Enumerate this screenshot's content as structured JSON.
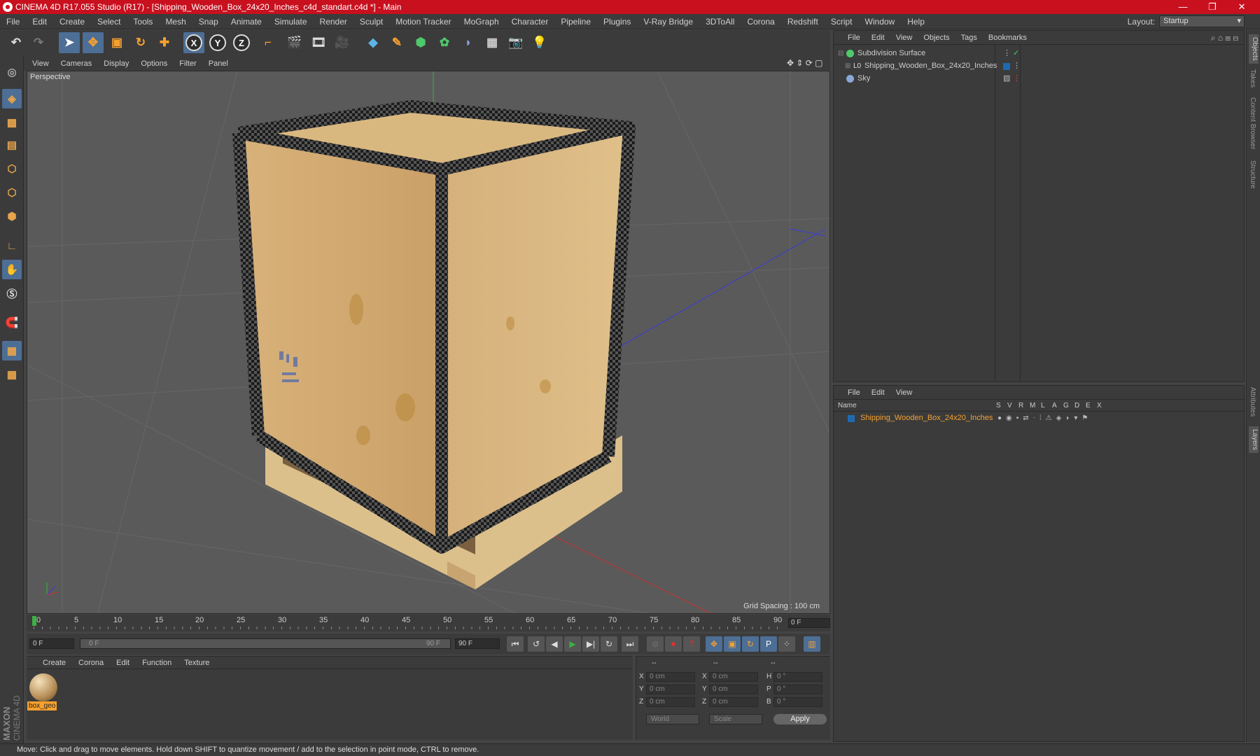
{
  "window": {
    "title": "CINEMA 4D R17.055 Studio (R17) - [Shipping_Wooden_Box_24x20_Inches_c4d_standart.c4d *] - Main",
    "minimize": "—",
    "maximize": "❐",
    "close": "✕"
  },
  "menu": [
    "File",
    "Edit",
    "Create",
    "Select",
    "Tools",
    "Mesh",
    "Snap",
    "Animate",
    "Simulate",
    "Render",
    "Sculpt",
    "Motion Tracker",
    "MoGraph",
    "Character",
    "Pipeline",
    "Plugins",
    "V-Ray Bridge",
    "3DToAll",
    "Corona",
    "Redshift",
    "Script",
    "Window",
    "Help"
  ],
  "layout": {
    "label": "Layout:",
    "value": "Startup"
  },
  "viewport": {
    "menu": [
      "View",
      "Cameras",
      "Display",
      "Options",
      "Filter",
      "Panel"
    ],
    "camera": "Perspective",
    "grid_spacing": "Grid Spacing : 100 cm"
  },
  "timeline": {
    "ticks": [
      "0",
      "5",
      "10",
      "15",
      "20",
      "25",
      "30",
      "35",
      "40",
      "45",
      "50",
      "55",
      "60",
      "65",
      "70",
      "75",
      "80",
      "85",
      "90"
    ],
    "current": "0 F"
  },
  "transport": {
    "start": "0 F",
    "range_start": "0 F",
    "range_end": "90 F",
    "end": "90 F"
  },
  "material_panel": {
    "menu": [
      "Create",
      "Corona",
      "Edit",
      "Function",
      "Texture"
    ],
    "material_name": "box_geo"
  },
  "coords": {
    "headers": [
      "--",
      "--",
      "--"
    ],
    "rows": [
      {
        "axis": "X",
        "pos": "0 cm",
        "axis2": "X",
        "size": "0 cm",
        "rot_label": "H",
        "rot": "0 °"
      },
      {
        "axis": "Y",
        "pos": "0 cm",
        "axis2": "Y",
        "size": "0 cm",
        "rot_label": "P",
        "rot": "0 °"
      },
      {
        "axis": "Z",
        "pos": "0 cm",
        "axis2": "Z",
        "size": "0 cm",
        "rot_label": "B",
        "rot": "0 °"
      }
    ],
    "mode1": "World",
    "mode2": "Scale",
    "apply": "Apply"
  },
  "objects_panel": {
    "menu": [
      "File",
      "Edit",
      "View",
      "Objects",
      "Tags",
      "Bookmarks"
    ],
    "items": [
      "Subdivision Surface",
      "Shipping_Wooden_Box_24x20_Inches",
      "Sky"
    ]
  },
  "layers_panel": {
    "menu": [
      "File",
      "Edit",
      "View"
    ],
    "columns": [
      "Name",
      "S",
      "V",
      "R",
      "M",
      "L",
      "A",
      "G",
      "D",
      "E",
      "X"
    ],
    "layer": "Shipping_Wooden_Box_24x20_Inches"
  },
  "right_tabs": [
    "Objects",
    "Takes",
    "Content Browser",
    "Structure",
    "Attributes",
    "Layers"
  ],
  "status": "Move: Click and drag to move elements. Hold down SHIFT to quantize movement / add to the selection in point mode, CTRL to remove.",
  "brand": "MAXON CINEMA 4D",
  "colors": {
    "title_red": "#c8101e",
    "accent_orange": "#f6a12f",
    "active_blue": "#4d6e95"
  }
}
